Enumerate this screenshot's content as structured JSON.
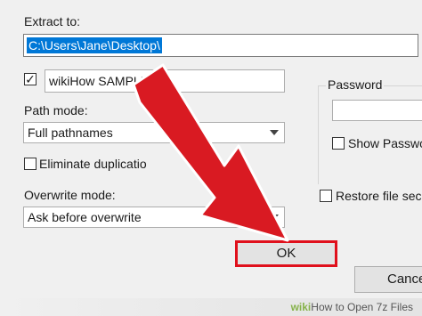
{
  "extract_to": {
    "label": "Extract to:",
    "path_value": "C:\\Users\\Jane\\Desktop\\"
  },
  "folder_name": {
    "checked": true,
    "value": "wikiHow SAMPLE"
  },
  "path_mode": {
    "label": "Path mode:",
    "selected": "Full pathnames"
  },
  "eliminate": {
    "label": "Eliminate duplicatio"
  },
  "overwrite_mode": {
    "label": "Overwrite mode:",
    "selected": "Ask before overwrite"
  },
  "password": {
    "label": "Password",
    "show_label": "Show Passwo",
    "restore_label": "Restore file secu"
  },
  "buttons": {
    "ok": "OK",
    "cancel": "Cance"
  },
  "highlight_color": "#e0101c",
  "arrow_color": "#e0101c",
  "watermark": {
    "brand": "wiki",
    "title": "How to Open 7z Files"
  }
}
